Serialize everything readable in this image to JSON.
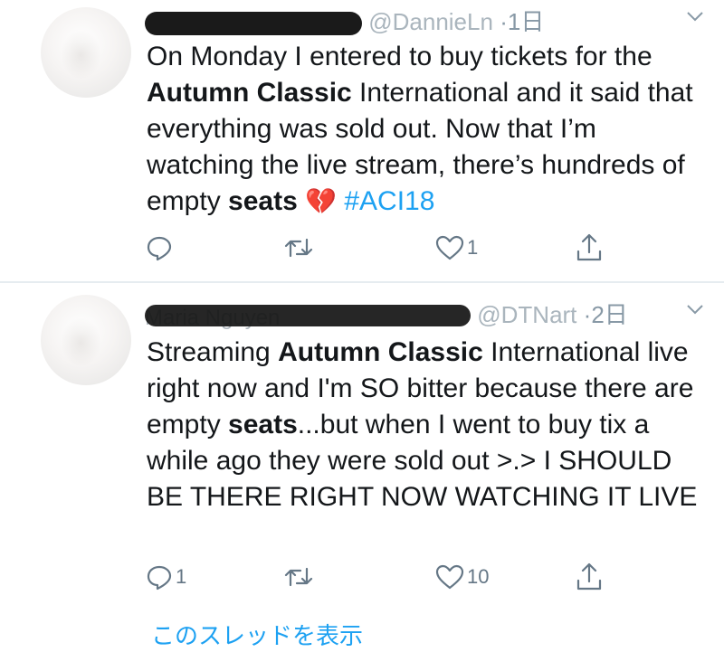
{
  "tweets": [
    {
      "handle": "@DannieLn",
      "time": "1日",
      "text": {
        "p1": "On Monday I entered to buy tickets for the ",
        "b1": "Autumn Classic",
        "p2": " International and it said that everything was sold out. Now that I’m watching the live stream, there’s hundreds of empty ",
        "b2": "seats",
        "emoji": "💔",
        "hashtag": "#ACI18"
      },
      "counts": {
        "reply": "",
        "retweet": "",
        "like": "1"
      }
    },
    {
      "name": "Maria Nguyen",
      "handle": "@DTNart",
      "time": "2日",
      "text": {
        "p1": "Streaming ",
        "b1": "Autumn Classic",
        "p2": " International live right now and I'm SO bitter because there are empty ",
        "b2": "seats",
        "p3": "...but when I went to buy tix a while ago they were sold out >.> I SHOULD BE THERE RIGHT NOW WATCHING IT LIVE"
      },
      "counts": {
        "reply": "1",
        "retweet": "",
        "like": "10"
      },
      "thread_link": "このスレッドを表示"
    }
  ],
  "icons": {
    "reply": "reply-icon",
    "retweet": "retweet-icon",
    "like": "heart-icon",
    "share": "share-icon",
    "more": "chevron-down-icon"
  },
  "colors": {
    "link": "#1da1f2",
    "muted": "#657786",
    "text": "#14171a",
    "divider": "#e6ecf0"
  }
}
